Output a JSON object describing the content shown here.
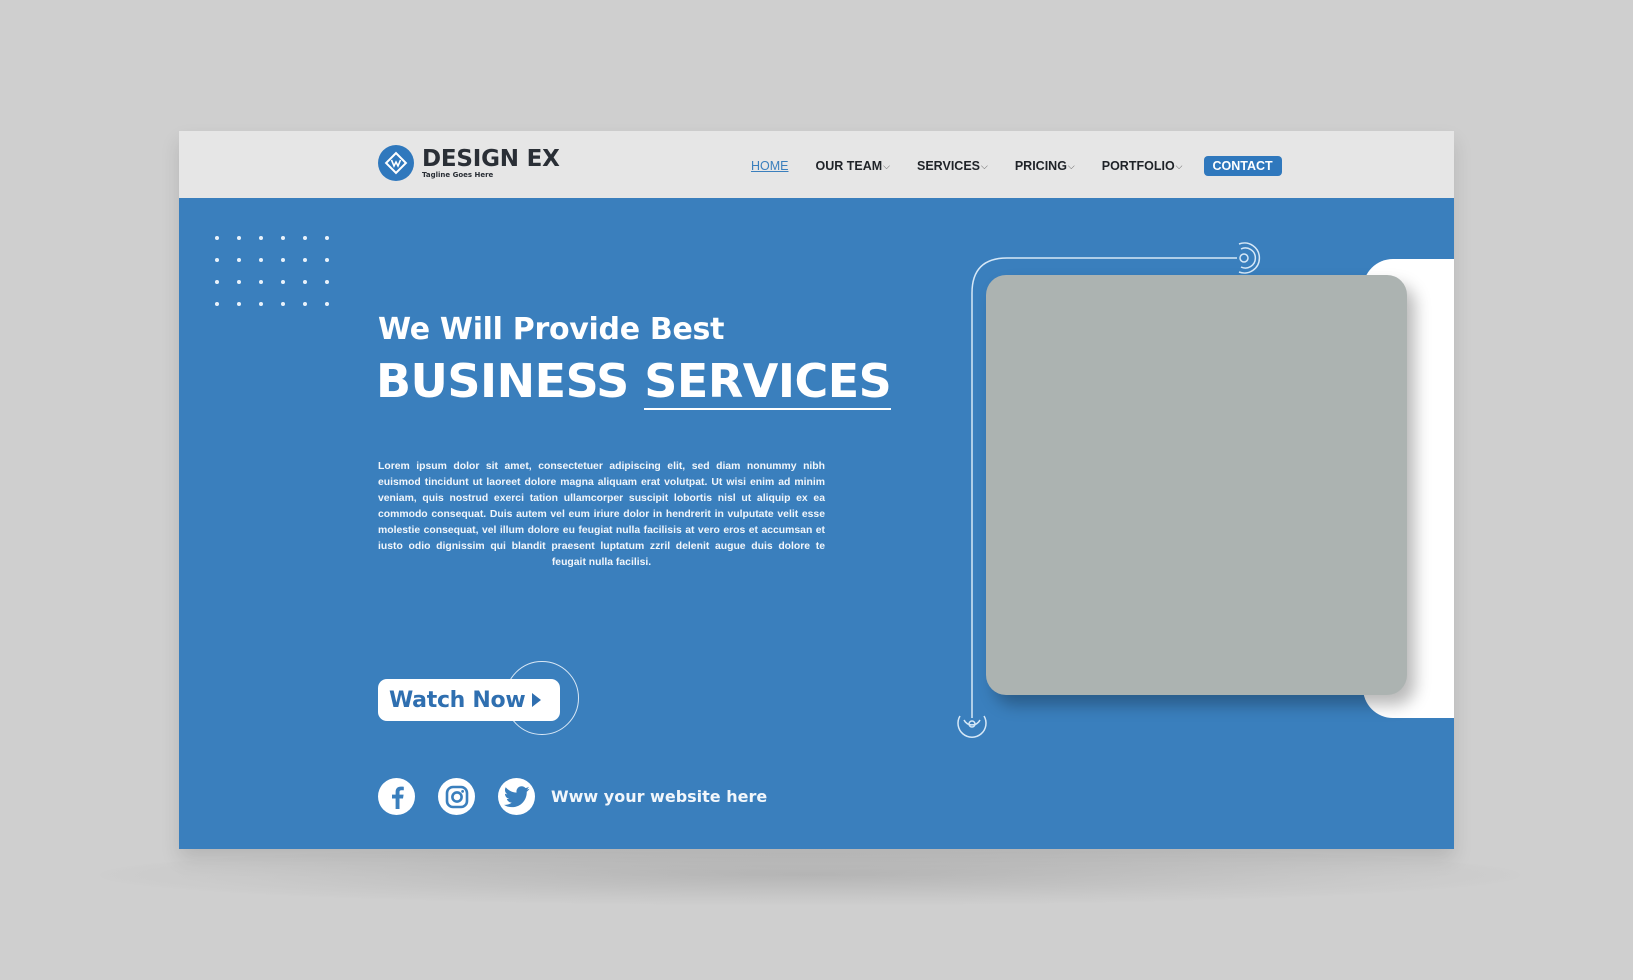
{
  "brand": {
    "name": "DESIGN EX",
    "tagline": "Tagline Goes Here",
    "logo_icon": "diamond-monogram-icon",
    "primary_color": "#3a7fbd",
    "accent_color": "#2f78bd"
  },
  "nav": {
    "items": [
      {
        "label": "HOME",
        "active": true,
        "has_dropdown": false
      },
      {
        "label": "OUR TEAM",
        "active": false,
        "has_dropdown": true
      },
      {
        "label": "SERVICES",
        "active": false,
        "has_dropdown": true
      },
      {
        "label": "PRICING",
        "active": false,
        "has_dropdown": true
      },
      {
        "label": "PORTFOLIO",
        "active": false,
        "has_dropdown": true
      }
    ],
    "dropdown_caret": "⌵",
    "contact_label": "CONTACT"
  },
  "hero": {
    "subheading": "We Will Provide Best",
    "headline_part1": "BUSINESS",
    "headline_part2": "SERVICES",
    "body": "Lorem ipsum dolor sit amet, consectetuer adipiscing elit, sed diam nonummy nibh euismod tincidunt ut laoreet dolore magna aliquam erat volutpat. Ut wisi enim ad minim veniam, quis nostrud exerci tation ullamcorper suscipit lobortis nisl ut aliquip ex ea commodo consequat. Duis autem vel eum iriure dolor in hendrerit in vulputate velit esse molestie consequat, vel illum dolore eu feugiat nulla facilisis at vero eros et accumsan et iusto odio dignissim qui blandit praesent luptatum zzril delenit augue duis dolore te feugait nulla facilisi.",
    "cta_label": "Watch Now",
    "cta_icon": "play-icon"
  },
  "social": {
    "icons": [
      "facebook-icon",
      "instagram-icon",
      "twitter-icon"
    ],
    "website": "Www your website here"
  },
  "image_placeholder": {
    "color": "#acb3b1"
  }
}
